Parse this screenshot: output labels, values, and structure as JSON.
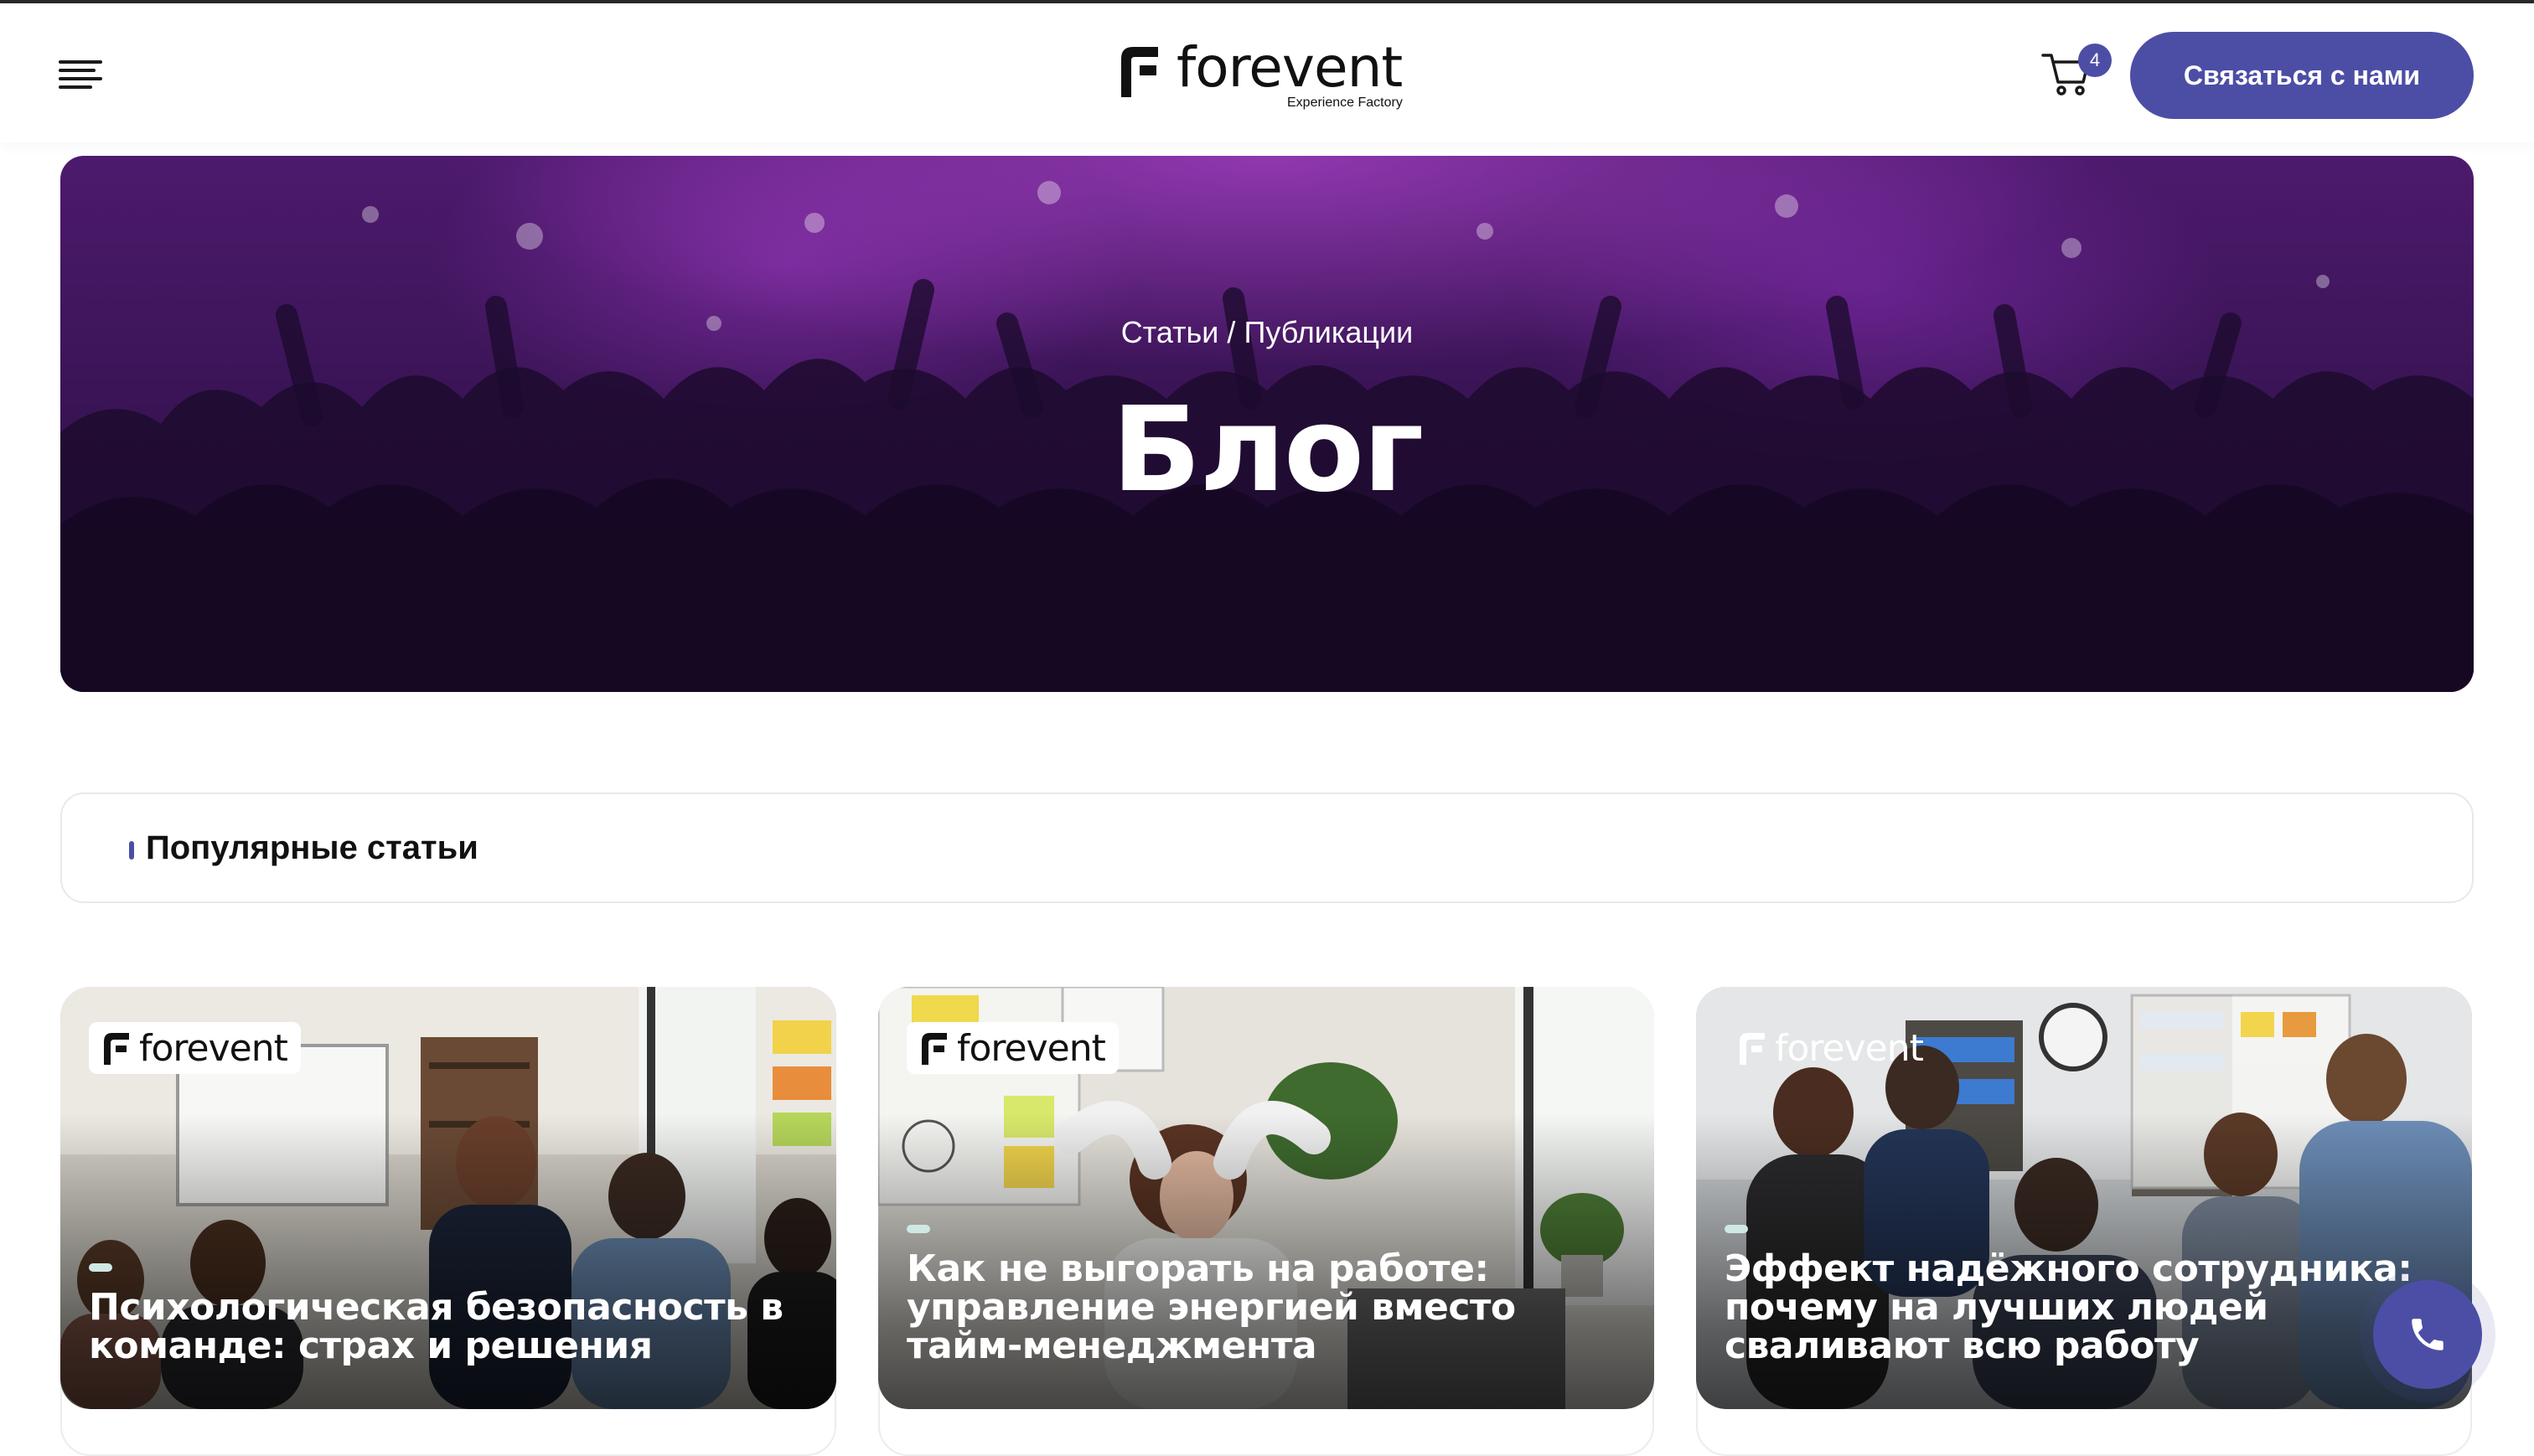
{
  "header": {
    "logo": {
      "word": "forevent",
      "subtitle": "Experience Factory"
    },
    "menu_icon": "hamburger-menu-icon",
    "cart": {
      "icon": "cart-icon",
      "count": "4"
    },
    "contact_label": "Связаться с нами"
  },
  "hero": {
    "breadcrumb": {
      "parent": "Статьи",
      "separator": " / ",
      "current": "Публикации"
    },
    "title": "Блог"
  },
  "popular": {
    "title": "Популярные статьи"
  },
  "articles": [
    {
      "badge": "forevent",
      "title": "Психологическая безопасность в команде: страх и решения"
    },
    {
      "badge": "forevent",
      "title": "Как не выгорать на работе: управление энергией вместо тайм-менеджмента"
    },
    {
      "badge": "forevent",
      "title": "Эффект надёжного сотрудника: почему на лучших людей сваливают всю работу"
    }
  ],
  "call_button": {
    "icon": "phone-icon"
  },
  "colors": {
    "accent": "#4c4ea6",
    "hero_purple": "#4d1a6d"
  }
}
